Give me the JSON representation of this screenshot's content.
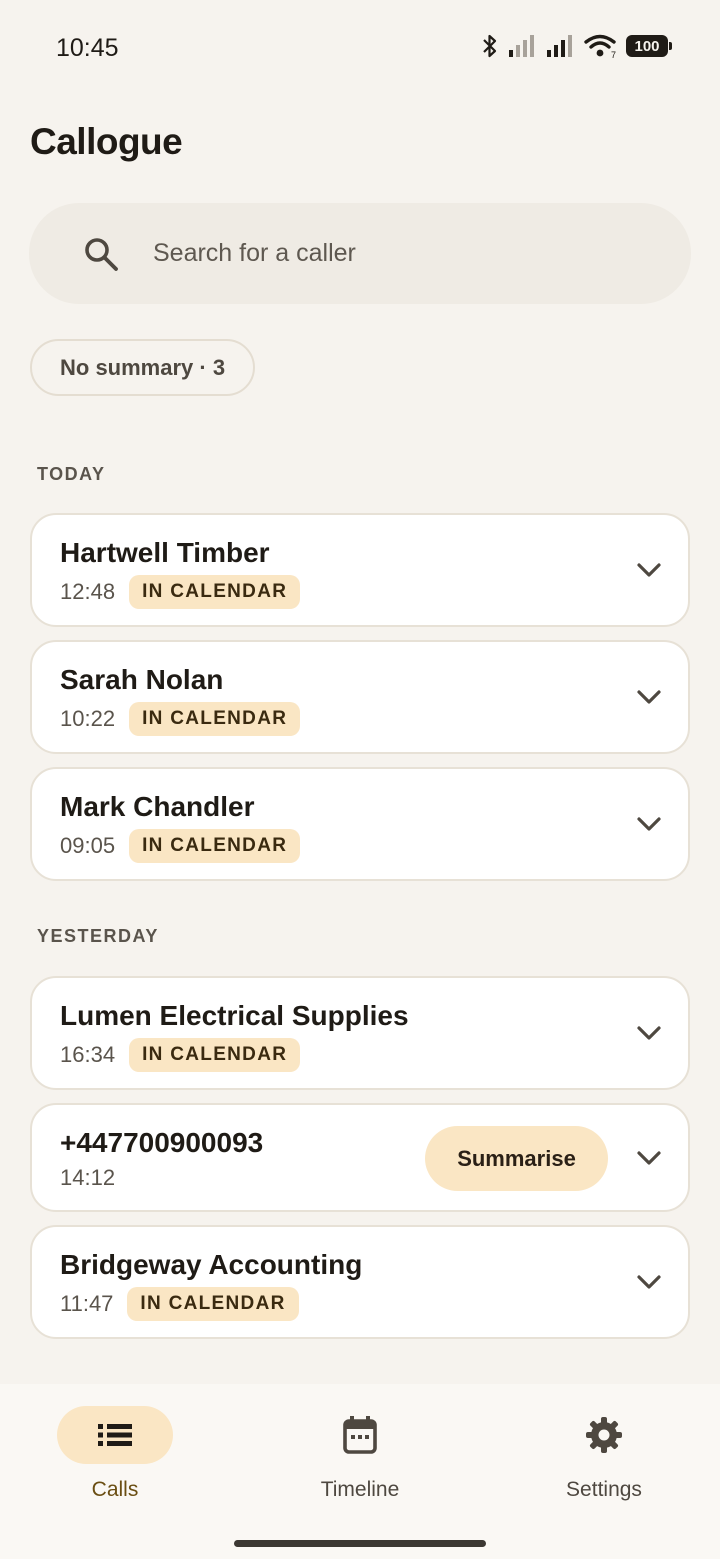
{
  "status_bar": {
    "time": "10:45",
    "battery": "100",
    "icons": [
      "bluetooth-icon",
      "signal-icon",
      "signal-icon",
      "wifi-icon",
      "battery-icon"
    ]
  },
  "app": {
    "title": "Callogue"
  },
  "search": {
    "placeholder": "Search for a caller",
    "icon": "search-icon"
  },
  "filter": {
    "label": "No summary · 3"
  },
  "sections": [
    {
      "label": "TODAY",
      "calls": [
        {
          "name": "Hartwell Timber",
          "time": "12:48",
          "badge": "IN CALENDAR"
        },
        {
          "name": "Sarah Nolan",
          "time": "10:22",
          "badge": "IN CALENDAR"
        },
        {
          "name": "Mark Chandler",
          "time": "09:05",
          "badge": "IN CALENDAR"
        }
      ]
    },
    {
      "label": "YESTERDAY",
      "calls": [
        {
          "name": "Lumen Electrical Supplies",
          "time": "16:34",
          "badge": "IN CALENDAR"
        },
        {
          "name": "+447700900093",
          "time": "14:12",
          "action": "Summarise"
        },
        {
          "name": "Bridgeway Accounting",
          "time": "11:47",
          "badge": "IN CALENDAR"
        }
      ]
    }
  ],
  "nav": {
    "items": [
      {
        "label": "Calls",
        "icon": "list-icon",
        "active": true
      },
      {
        "label": "Timeline",
        "icon": "calendar-icon",
        "active": false
      },
      {
        "label": "Settings",
        "icon": "gear-icon",
        "active": false
      }
    ]
  },
  "colors": {
    "background": "#f6f3ee",
    "accent": "#fae6c4",
    "accent_text": "#6a4e12",
    "card": "#ffffff",
    "text": "#1f1b16"
  }
}
